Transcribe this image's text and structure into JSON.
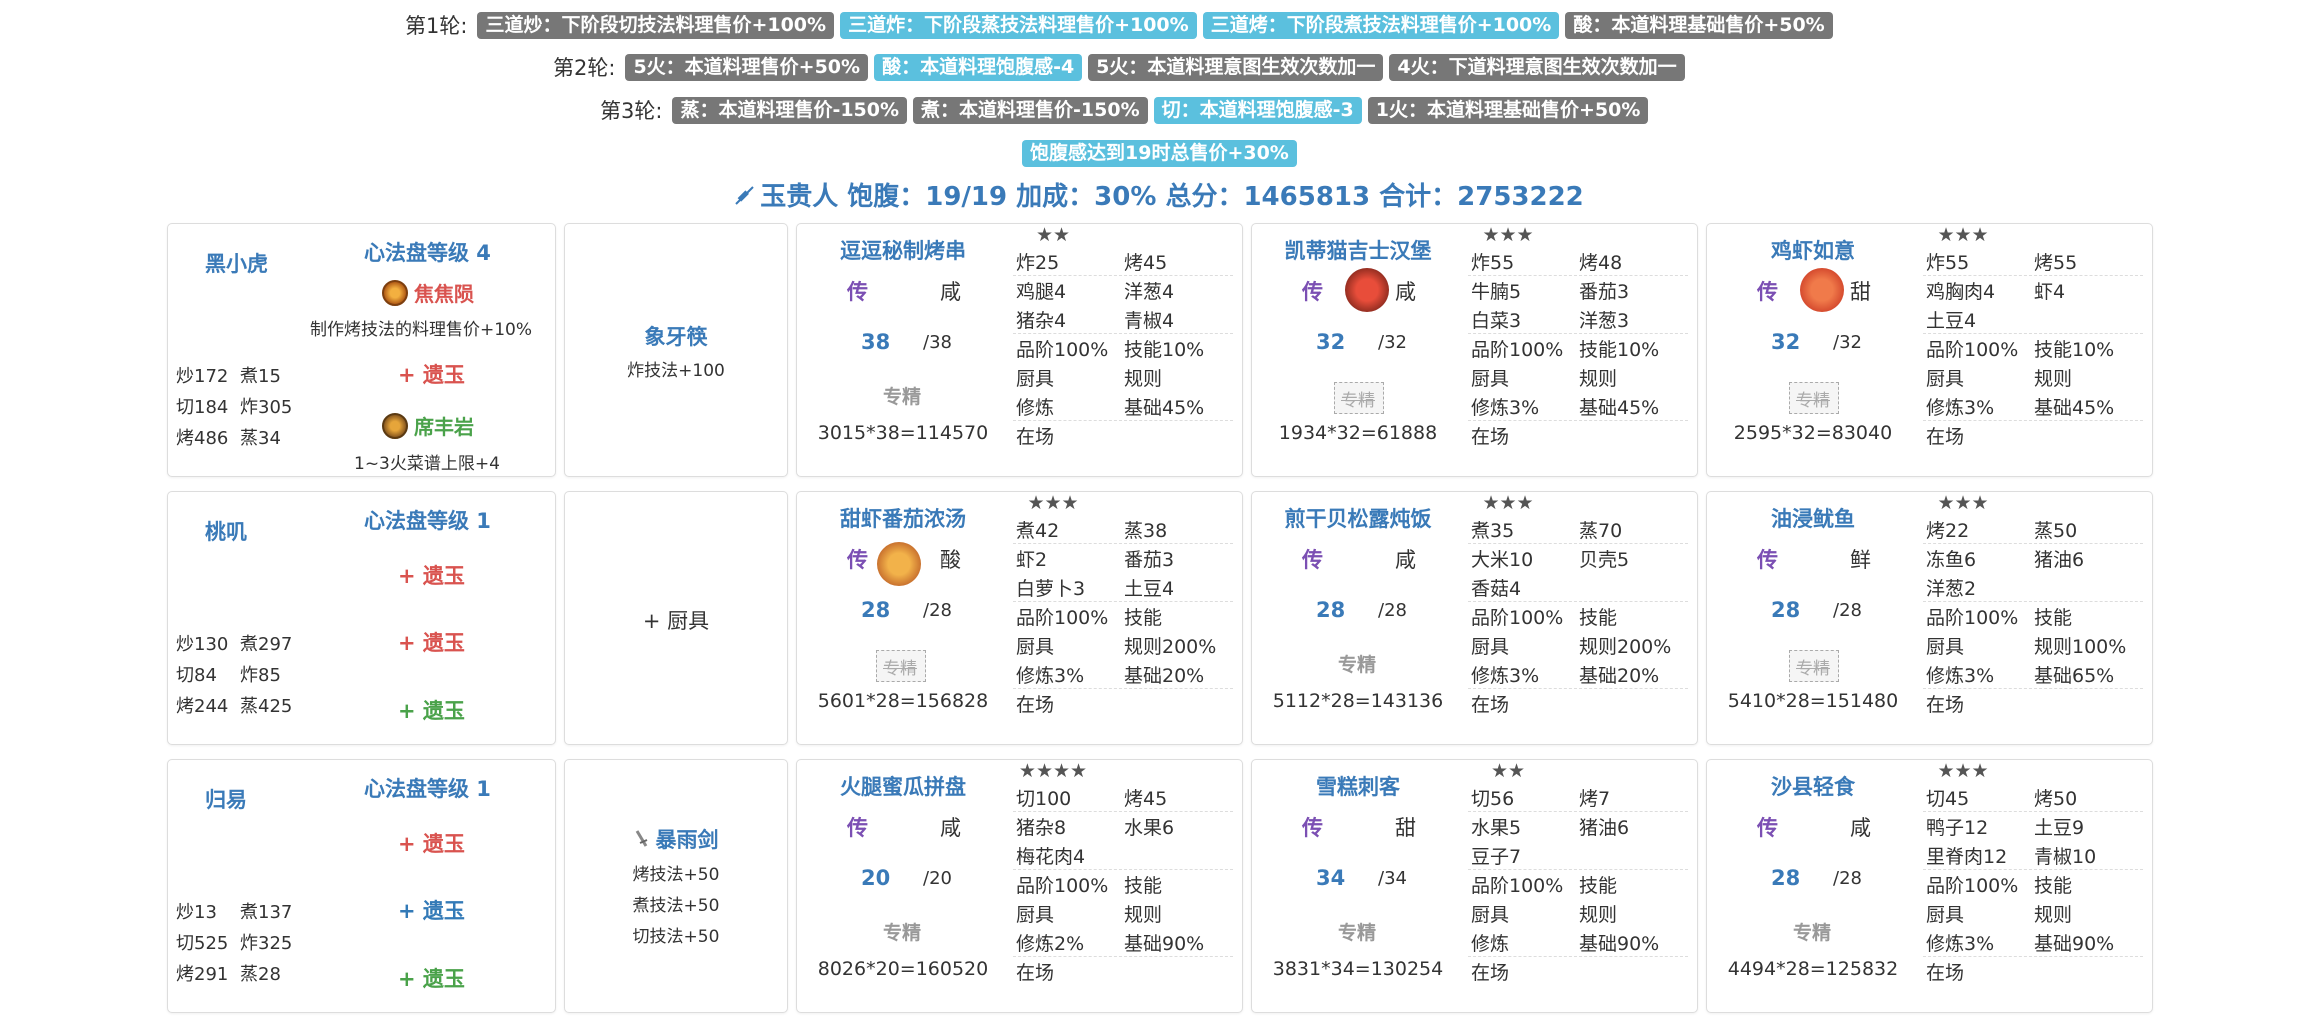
{
  "rules": {
    "round1_label": "第1轮:",
    "round1_tags": [
      "三道炒：下阶段切技法料理售价+100%",
      "三道炸：下阶段蒸技法料理售价+100%",
      "三道烤：下阶段煮技法料理售价+100%",
      "酸：本道料理基础售价+50%"
    ],
    "round2_label": "第2轮:",
    "round2_tags": [
      "5火：本道料理售价+50%",
      "酸：本道料理饱腹感-4",
      "5火：本道料理意图生效次数加一",
      "4火：下道料理意图生效次数加一"
    ],
    "round3_label": "第3轮:",
    "round3_tags": [
      "蒸：本道料理售价-150%",
      "煮：本道料理售价-150%",
      "切：本道料理饱腹感-3",
      "1火：本道料理基础售价+50%"
    ],
    "extra_tag": "饱腹感达到19时总售价+30%"
  },
  "summary": {
    "icon": "syringe-icon",
    "text": "玉贵人 饱腹：19/19 加成：30% 总分：1465813 合计：2753222"
  },
  "rows": [
    {
      "chef": {
        "name": "黑小虎",
        "level": "心法盘等级 4",
        "stats": [
          "炒172",
          "煮15",
          "切184",
          "炸305",
          "烤486",
          "蒸34"
        ],
        "assist1_name": "焦焦陨",
        "assist1_desc": "制作烤技法的料理售价+10%",
        "relic1": "+ 遗玉",
        "assist2_name": "席丰岩",
        "assist2_desc": "1~3火菜谱上限+4"
      },
      "equip": {
        "name": "象牙筷",
        "skills": [
          "炸技法+100"
        ]
      },
      "recipes": [
        {
          "name": "逗逗秘制烤串",
          "rarity": "★★",
          "chuan": "传",
          "flavor": "咸",
          "qty": "38",
          "qty_max": "/38",
          "zhuanjing": "专精",
          "price": "3015*38=114570",
          "cells": [
            [
              "炸25",
              "烤45"
            ],
            [
              "鸡腿4",
              "洋葱4"
            ],
            [
              "猪杂4",
              "青椒4"
            ],
            [
              "品阶100%",
              "技能10%"
            ],
            [
              "厨具",
              "规则"
            ],
            [
              "修炼",
              "基础45%"
            ],
            [
              "在场",
              ""
            ]
          ]
        },
        {
          "name": "凯蒂猫吉士汉堡",
          "rarity": "★★★",
          "chuan": "传",
          "flavor": "咸",
          "qty": "32",
          "qty_max": "/32",
          "zhuanjing": "专精",
          "price": "1934*32=61888",
          "cells": [
            [
              "炸55",
              "烤48"
            ],
            [
              "牛腩5",
              "番茄3"
            ],
            [
              "白菜3",
              "洋葱3"
            ],
            [
              "品阶100%",
              "技能10%"
            ],
            [
              "厨具",
              "规则"
            ],
            [
              "修炼3%",
              "基础45%"
            ],
            [
              "在场",
              ""
            ]
          ]
        },
        {
          "name": "鸡虾如意",
          "rarity": "★★★",
          "chuan": "传",
          "flavor": "甜",
          "qty": "32",
          "qty_max": "/32",
          "zhuanjing": "专精",
          "price": "2595*32=83040",
          "cells": [
            [
              "炸55",
              "烤55"
            ],
            [
              "鸡胸肉4",
              "虾4"
            ],
            [
              "土豆4",
              ""
            ],
            [
              "品阶100%",
              "技能10%"
            ],
            [
              "厨具",
              "规则"
            ],
            [
              "修炼3%",
              "基础45%"
            ],
            [
              "在场",
              ""
            ]
          ]
        }
      ]
    },
    {
      "chef": {
        "name": "桃叽",
        "level": "心法盘等级 1",
        "stats": [
          "炒130",
          "煮297",
          "切84",
          "炸85",
          "烤244",
          "蒸425"
        ],
        "relics": [
          "+ 遗玉",
          "+ 遗玉",
          "+ 遗玉"
        ]
      },
      "equip": {
        "name": "+ 厨具"
      },
      "recipes": [
        {
          "name": "甜虾番茄浓汤",
          "rarity": "★★★",
          "chuan": "传",
          "flavor": "酸",
          "qty": "28",
          "qty_max": "/28",
          "zhuanjing": "专精",
          "price": "5601*28=156828",
          "cells": [
            [
              "煮42",
              "蒸38"
            ],
            [
              "虾2",
              "番茄3"
            ],
            [
              "白萝卜3",
              "土豆4"
            ],
            [
              "品阶100%",
              "技能"
            ],
            [
              "厨具",
              "规则200%"
            ],
            [
              "修炼3%",
              "基础20%"
            ],
            [
              "在场",
              ""
            ]
          ]
        },
        {
          "name": "煎干贝松露炖饭",
          "rarity": "★★★",
          "chuan": "传",
          "flavor": "咸",
          "qty": "28",
          "qty_max": "/28",
          "zhuanjing": "专精",
          "price": "5112*28=143136",
          "cells": [
            [
              "煮35",
              "蒸70"
            ],
            [
              "大米10",
              "贝壳5"
            ],
            [
              "香菇4",
              ""
            ],
            [
              "品阶100%",
              "技能"
            ],
            [
              "厨具",
              "规则200%"
            ],
            [
              "修炼3%",
              "基础20%"
            ],
            [
              "在场",
              ""
            ]
          ]
        },
        {
          "name": "油浸鱿鱼",
          "rarity": "★★★",
          "chuan": "传",
          "flavor": "鲜",
          "qty": "28",
          "qty_max": "/28",
          "zhuanjing": "专精",
          "price": "5410*28=151480",
          "cells": [
            [
              "烤22",
              "蒸50"
            ],
            [
              "冻鱼6",
              "猪油6"
            ],
            [
              "洋葱2",
              ""
            ],
            [
              "品阶100%",
              "技能"
            ],
            [
              "厨具",
              "规则100%"
            ],
            [
              "修炼3%",
              "基础65%"
            ],
            [
              "在场",
              ""
            ]
          ]
        }
      ]
    },
    {
      "chef": {
        "name": "归易",
        "level": "心法盘等级 1",
        "stats": [
          "炒13",
          "煮137",
          "切525",
          "炸325",
          "烤291",
          "蒸28"
        ],
        "relics": [
          "+ 遗玉",
          "+ 遗玉",
          "+ 遗玉"
        ]
      },
      "equip": {
        "name": "暴雨剑",
        "skills": [
          "烤技法+50",
          "煮技法+50",
          "切技法+50"
        ]
      },
      "recipes": [
        {
          "name": "火腿蜜瓜拼盘",
          "rarity": "★★★★",
          "chuan": "传",
          "flavor": "咸",
          "qty": "20",
          "qty_max": "/20",
          "zhuanjing": "专精",
          "price": "8026*20=160520",
          "cells": [
            [
              "切100",
              "烤45"
            ],
            [
              "猪杂8",
              "水果6"
            ],
            [
              "梅花肉4",
              ""
            ],
            [
              "品阶100%",
              "技能"
            ],
            [
              "厨具",
              "规则"
            ],
            [
              "修炼2%",
              "基础90%"
            ],
            [
              "在场",
              ""
            ]
          ]
        },
        {
          "name": "雪糕刺客",
          "rarity": "★★",
          "chuan": "传",
          "flavor": "甜",
          "qty": "34",
          "qty_max": "/34",
          "zhuanjing": "专精",
          "price": "3831*34=130254",
          "cells": [
            [
              "切56",
              "烤7"
            ],
            [
              "水果5",
              "猪油6"
            ],
            [
              "豆子7",
              ""
            ],
            [
              "品阶100%",
              "技能"
            ],
            [
              "厨具",
              "规则"
            ],
            [
              "修炼",
              "基础90%"
            ],
            [
              "在场",
              ""
            ]
          ]
        },
        {
          "name": "沙县轻食",
          "rarity": "★★★",
          "chuan": "传",
          "flavor": "咸",
          "qty": "28",
          "qty_max": "/28",
          "zhuanjing": "专精",
          "price": "4494*28=125832",
          "cells": [
            [
              "切45",
              "烤50"
            ],
            [
              "鸭子12",
              "土豆9"
            ],
            [
              "里脊肉12",
              "青椒10"
            ],
            [
              "品阶100%",
              "技能"
            ],
            [
              "厨具",
              "规则"
            ],
            [
              "修炼3%",
              "基础90%"
            ],
            [
              "在场",
              ""
            ]
          ]
        }
      ]
    }
  ],
  "colors": {
    "grey_badge": "#777777",
    "blue_badge": "#5bc0de",
    "title_blue": "#3a7ab8",
    "chuan_purple": "#7b4fb3",
    "relic_red": "#d9534f",
    "relic_blue": "#337ab7",
    "relic_green": "#4aa24a"
  }
}
